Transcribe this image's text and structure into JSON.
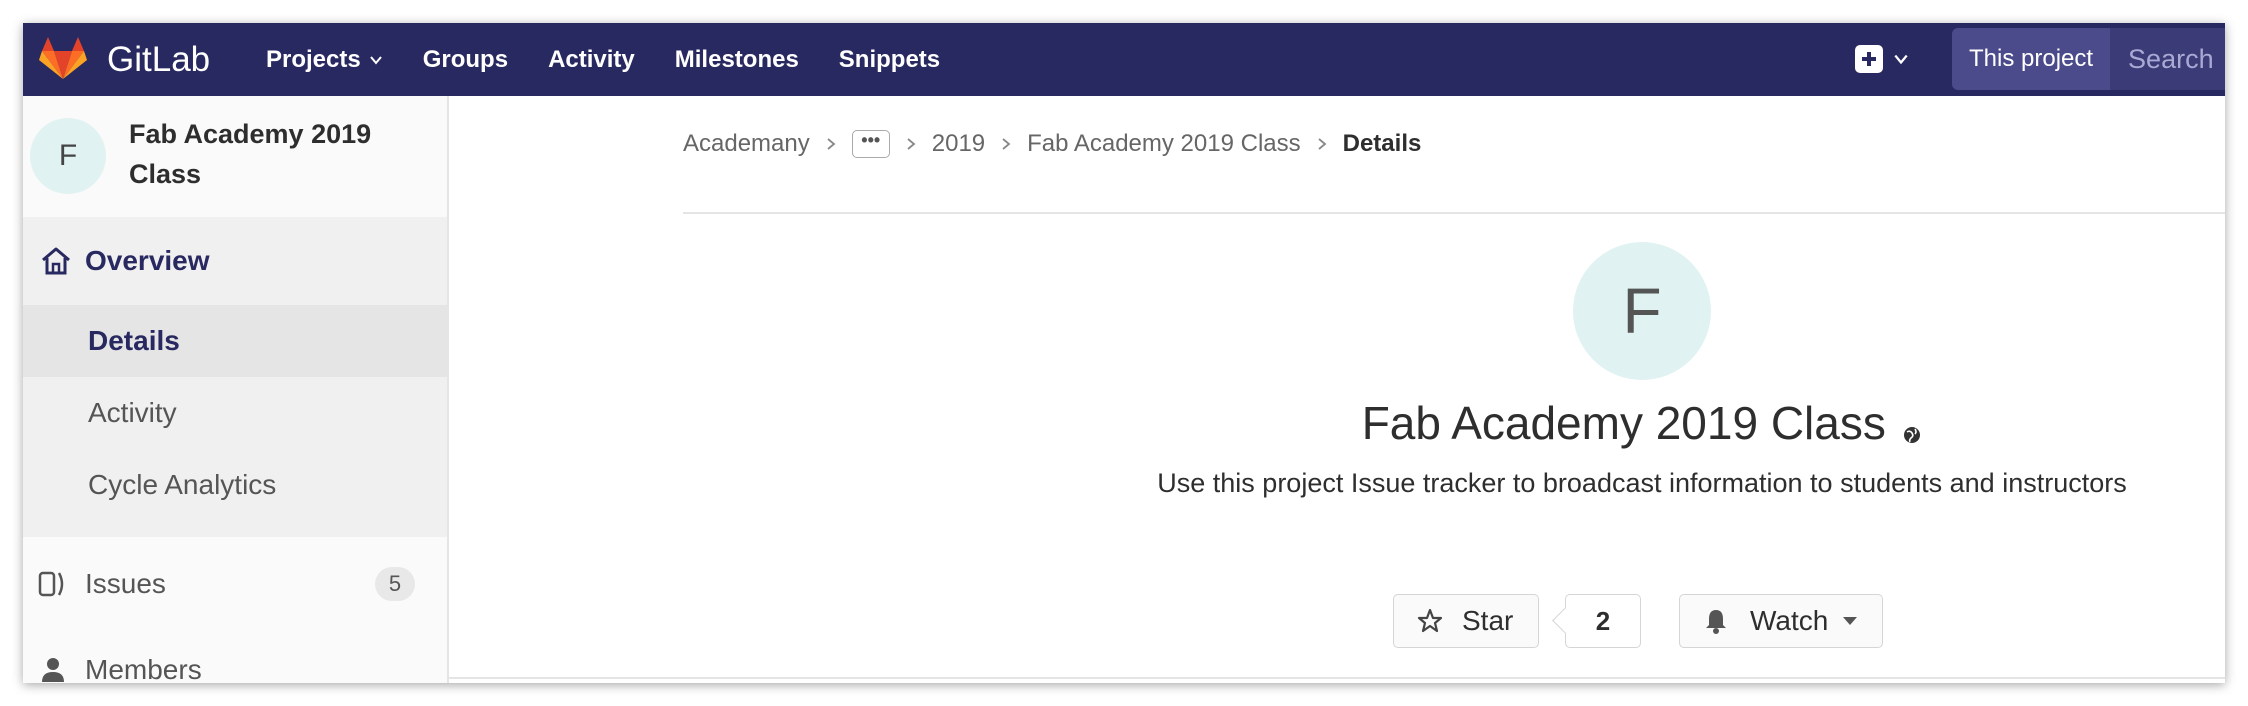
{
  "navbar": {
    "brand": "GitLab",
    "links": [
      {
        "label": "Projects",
        "dropdown": true
      },
      {
        "label": "Groups"
      },
      {
        "label": "Activity"
      },
      {
        "label": "Milestones"
      },
      {
        "label": "Snippets"
      }
    ],
    "search_scope": "This project",
    "search_placeholder": "Search",
    "colors": {
      "bg": "#292961",
      "accent": "#fc6d26"
    }
  },
  "sidebar": {
    "project_initial": "F",
    "project_name": "Fab Academy 2019 Class",
    "overview_label": "Overview",
    "sub_items": [
      "Details",
      "Activity",
      "Cycle Analytics"
    ],
    "issues_label": "Issues",
    "issues_count": "5",
    "members_label": "Members"
  },
  "breadcrumb": {
    "items": [
      "Academany",
      "2019",
      "Fab Academy 2019 Class"
    ],
    "ellipsis": "•••",
    "current": "Details"
  },
  "project": {
    "initial": "F",
    "title": "Fab Academy 2019 Class",
    "description": "Use this project Issue tracker to broadcast information to students and instructors",
    "star_label": "Star",
    "star_count": "2",
    "watch_label": "Watch"
  }
}
